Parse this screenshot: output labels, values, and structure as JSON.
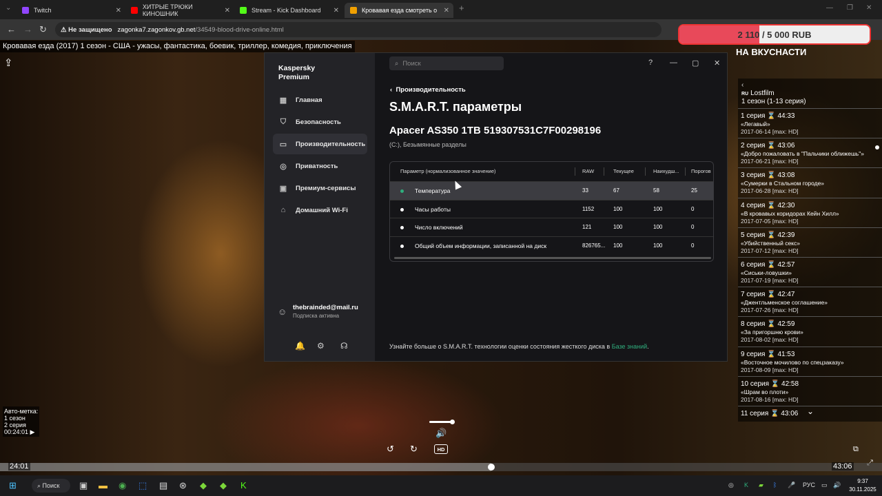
{
  "browser": {
    "tabs": [
      {
        "title": "Twitch",
        "favicon_color": "#9146ff"
      },
      {
        "title": "ХИТРЫЕ ТРЮКИ КИНОШНИК",
        "favicon_color": "#ff0000"
      },
      {
        "title": "Stream - Kick Dashboard",
        "favicon_color": "#53fc18"
      },
      {
        "title": "Кровавая езда смотреть о",
        "favicon_color": "#f0a000"
      }
    ],
    "security_label": "Не защищено",
    "url_host": "zagonka7.zagonkov.gb.net",
    "url_path": "/34549-blood-drive-online.html"
  },
  "video": {
    "title": "Кровавая езда (2017) 1 сезон - США - ужасы, фантастика, боевик, триллер, комедия, приключения",
    "current_time": "24:01",
    "total_time": "43:06",
    "progress_fraction": 0.557,
    "volume_fraction": 1.0,
    "hd_label": "HD",
    "auto_mark": {
      "title": "Авто-метка:",
      "season": "1 сезон",
      "episode": "2 серия",
      "time": "00:24:01 ▶"
    }
  },
  "donation": {
    "current": "2 110",
    "separator": " / ",
    "goal": "5 000 RUB",
    "fraction": 0.422
  },
  "vkusnasti": "НА ВКУСНАСТИ",
  "episodes": {
    "back": "‹",
    "flag": "RU",
    "source": "Lostfilm",
    "season": "1 сезон (1-13 серия)",
    "items": [
      {
        "head": "1 серия ⌛ 44:33",
        "name": "«Легавый»",
        "date": "2017-06-14 [max: HD]"
      },
      {
        "head": "2 серия ⌛ 43:06",
        "name": "«Добро пожаловать в \"Пальчики оближешь\"»",
        "date": "2017-06-21 [max: HD]",
        "current": true
      },
      {
        "head": "3 серия ⌛ 43:08",
        "name": "«Сумерки в Стальном городе»",
        "date": "2017-06-28 [max: HD]"
      },
      {
        "head": "4 серия ⌛ 42:30",
        "name": "«В кровавых коридорах Кейн Хилл»",
        "date": "2017-07-05 [max: HD]"
      },
      {
        "head": "5 серия ⌛ 42:39",
        "name": "«Убийственный секс»",
        "date": "2017-07-12 [max: HD]"
      },
      {
        "head": "6 серия ⌛ 42:57",
        "name": "«Сиськи-ловушки»",
        "date": "2017-07-19 [max: HD]"
      },
      {
        "head": "7 серия ⌛ 42:47",
        "name": "«Джентльменское соглашение»",
        "date": "2017-07-26 [max: HD]"
      },
      {
        "head": "8 серия ⌛ 42:59",
        "name": "«За пригоршню крови»",
        "date": "2017-08-02 [max: HD]"
      },
      {
        "head": "9 серия ⌛ 41:53",
        "name": "«Восточное мочилово по спецзаказу»",
        "date": "2017-08-09 [max: HD]"
      },
      {
        "head": "10 серия ⌛ 42:58",
        "name": "«Шрам во плоти»",
        "date": "2017-08-16 [max: HD]"
      },
      {
        "head": "11 серия ⌛ 43:06",
        "name": "",
        "date": ""
      }
    ]
  },
  "kaspersky": {
    "brand_line1": "Kaspersky",
    "brand_line2": "Premium",
    "search_placeholder": "Поиск",
    "nav": [
      {
        "label": "Главная",
        "icon": "home-icon"
      },
      {
        "label": "Безопасность",
        "icon": "shield-icon"
      },
      {
        "label": "Производительность",
        "icon": "monitor-icon",
        "active": true
      },
      {
        "label": "Приватность",
        "icon": "privacy-icon"
      },
      {
        "label": "Премиум-сервисы",
        "icon": "crown-icon"
      },
      {
        "label": "Домашний Wi-Fi",
        "icon": "wifi-icon"
      }
    ],
    "user_email": "thebrainded@mail.ru",
    "user_status": "Подписка активна",
    "breadcrumb": "Производительность",
    "title": "S.M.A.R.T. параметры",
    "disk_name": "Apacer AS350 1TB 519307531C7F00298196",
    "disk_partitions": "(C:), Безымянные разделы",
    "table": {
      "headers": [
        "Параметр (нормализованное значение)",
        "RAW",
        "Текущее",
        "Наихудш...",
        "Порогов"
      ],
      "rows": [
        {
          "name": "Температура",
          "raw": "33",
          "current": "67",
          "worst": "58",
          "threshold": "25",
          "status": "good"
        },
        {
          "name": "Часы работы",
          "raw": "1152",
          "current": "100",
          "worst": "100",
          "threshold": "0",
          "status": "normal"
        },
        {
          "name": "Число включений",
          "raw": "121",
          "current": "100",
          "worst": "100",
          "threshold": "0",
          "status": "normal"
        },
        {
          "name": "Общий объем информации, записанной на диск",
          "raw": "826765...",
          "current": "100",
          "worst": "100",
          "threshold": "0",
          "status": "normal"
        }
      ]
    },
    "footer_text": "Узнайте больше о S.M.A.R.T. технологии оценки состояния жесткого диска в ",
    "footer_link": "Базе знаний",
    "footer_end": ".",
    "colors": {
      "accent": "#2fae7d",
      "bg": "#151518",
      "sidebar": "#232327"
    }
  },
  "taskbar": {
    "search_label": "Поиск",
    "lang": "РУС",
    "time": "9:37",
    "date": "30.11.2025"
  }
}
